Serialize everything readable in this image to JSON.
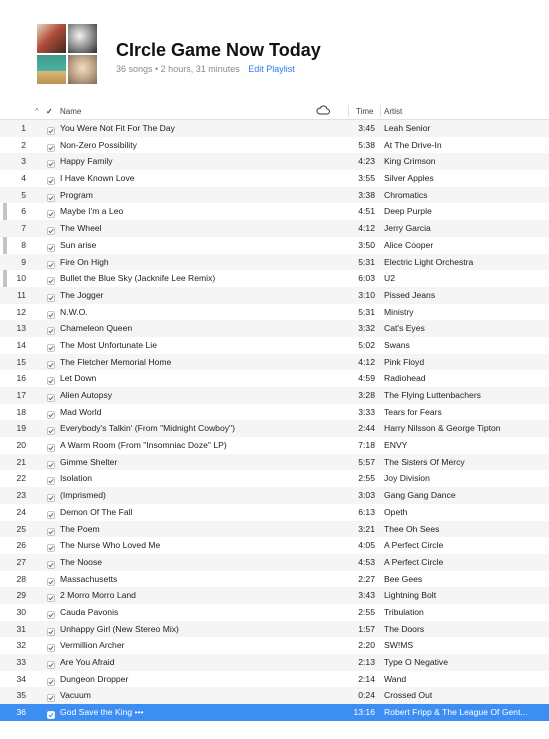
{
  "playlist": {
    "title": "CIrcle Game Now Today",
    "meta": "36 songs • 2 hours, 31 minutes",
    "edit_label": "Edit Playlist"
  },
  "columns": {
    "sort_indicator": "^",
    "check": "✓",
    "name": "Name",
    "time": "Time",
    "artist": "Artist"
  },
  "tracks": [
    {
      "num": "1",
      "name": "You Were Not Fit For The Day",
      "time": "3:45",
      "artist": "Leah Senior"
    },
    {
      "num": "2",
      "name": "Non-Zero Possibility",
      "time": "5:38",
      "artist": "At The Drive-In"
    },
    {
      "num": "3",
      "name": "Happy Family",
      "time": "4:23",
      "artist": "King Crimson"
    },
    {
      "num": "4",
      "name": "I Have Known Love",
      "time": "3:55",
      "artist": "Silver Apples"
    },
    {
      "num": "5",
      "name": "Program",
      "time": "3:38",
      "artist": "Chromatics"
    },
    {
      "num": "6",
      "name": "Maybe I'm a Leo",
      "time": "4:51",
      "artist": "Deep Purple"
    },
    {
      "num": "7",
      "name": "The Wheel",
      "time": "4:12",
      "artist": "Jerry Garcia"
    },
    {
      "num": "8",
      "name": "Sun arise",
      "time": "3:50",
      "artist": "Alice Cooper"
    },
    {
      "num": "9",
      "name": "Fire On High",
      "time": "5:31",
      "artist": "Electric Light Orchestra"
    },
    {
      "num": "10",
      "name": "Bullet the Blue Sky (Jacknife Lee Remix)",
      "time": "6:03",
      "artist": "U2"
    },
    {
      "num": "11",
      "name": "The Jogger",
      "time": "3:10",
      "artist": "Pissed Jeans"
    },
    {
      "num": "12",
      "name": "N.W.O.",
      "time": "5:31",
      "artist": "Ministry"
    },
    {
      "num": "13",
      "name": "Chameleon Queen",
      "time": "3:32",
      "artist": "Cat's Eyes"
    },
    {
      "num": "14",
      "name": "The Most Unfortunate Lie",
      "time": "5:02",
      "artist": "Swans"
    },
    {
      "num": "15",
      "name": "The Fletcher Memorial Home",
      "time": "4:12",
      "artist": "Pink Floyd"
    },
    {
      "num": "16",
      "name": "Let Down",
      "time": "4:59",
      "artist": "Radiohead"
    },
    {
      "num": "17",
      "name": "Alien Autopsy",
      "time": "3:28",
      "artist": "The Flying Luttenbachers"
    },
    {
      "num": "18",
      "name": "Mad World",
      "time": "3:33",
      "artist": "Tears for Fears"
    },
    {
      "num": "19",
      "name": "Everybody's Talkin' (From \"Midnight Cowboy\")",
      "time": "2:44",
      "artist": "Harry Nilsson & George Tipton"
    },
    {
      "num": "20",
      "name": "A Warm Room (From \"Insomniac Doze\" LP)",
      "time": "7:18",
      "artist": "ENVY"
    },
    {
      "num": "21",
      "name": "Gimme Shelter",
      "time": "5:57",
      "artist": "The Sisters Of Mercy"
    },
    {
      "num": "22",
      "name": "Isolation",
      "time": "2:55",
      "artist": "Joy Division"
    },
    {
      "num": "23",
      "name": "(Imprismed)",
      "time": "3:03",
      "artist": "Gang Gang Dance"
    },
    {
      "num": "24",
      "name": "Demon Of The Fall",
      "time": "6:13",
      "artist": "Opeth"
    },
    {
      "num": "25",
      "name": "The Poem",
      "time": "3:21",
      "artist": "Thee Oh Sees"
    },
    {
      "num": "26",
      "name": "The Nurse Who Loved Me",
      "time": "4:05",
      "artist": "A Perfect Circle"
    },
    {
      "num": "27",
      "name": "The Noose",
      "time": "4:53",
      "artist": "A Perfect Circle"
    },
    {
      "num": "28",
      "name": "Massachusetts",
      "time": "2:27",
      "artist": "Bee Gees"
    },
    {
      "num": "29",
      "name": "2 Morro Morro Land",
      "time": "3:43",
      "artist": "Lightning Bolt"
    },
    {
      "num": "30",
      "name": "Cauda Pavonis",
      "time": "2:55",
      "artist": "Tribulation"
    },
    {
      "num": "31",
      "name": "Unhappy Girl (New Stereo Mix)",
      "time": "1:57",
      "artist": "The Doors"
    },
    {
      "num": "32",
      "name": "Vermillion Archer",
      "time": "2:20",
      "artist": "SW!MS"
    },
    {
      "num": "33",
      "name": "Are You Afraid",
      "time": "2:13",
      "artist": "Type O Negative"
    },
    {
      "num": "34",
      "name": "Dungeon Dropper",
      "time": "2:14",
      "artist": "Wand"
    },
    {
      "num": "35",
      "name": "Vacuum",
      "time": "0:24",
      "artist": "Crossed Out"
    },
    {
      "num": "36",
      "name": "God Save the King  •••",
      "time": "13:16",
      "artist": "Robert Fripp & The League Of Gent...",
      "selected": true
    }
  ],
  "colors": {
    "accent": "#3d8ef2",
    "link": "#2a7ee6",
    "stripe": "#f5f5f5"
  },
  "icons": {
    "artwork": "playlist-artwork-mosaic",
    "cloud": "cloud-icon",
    "check": "checkbox-icon"
  }
}
